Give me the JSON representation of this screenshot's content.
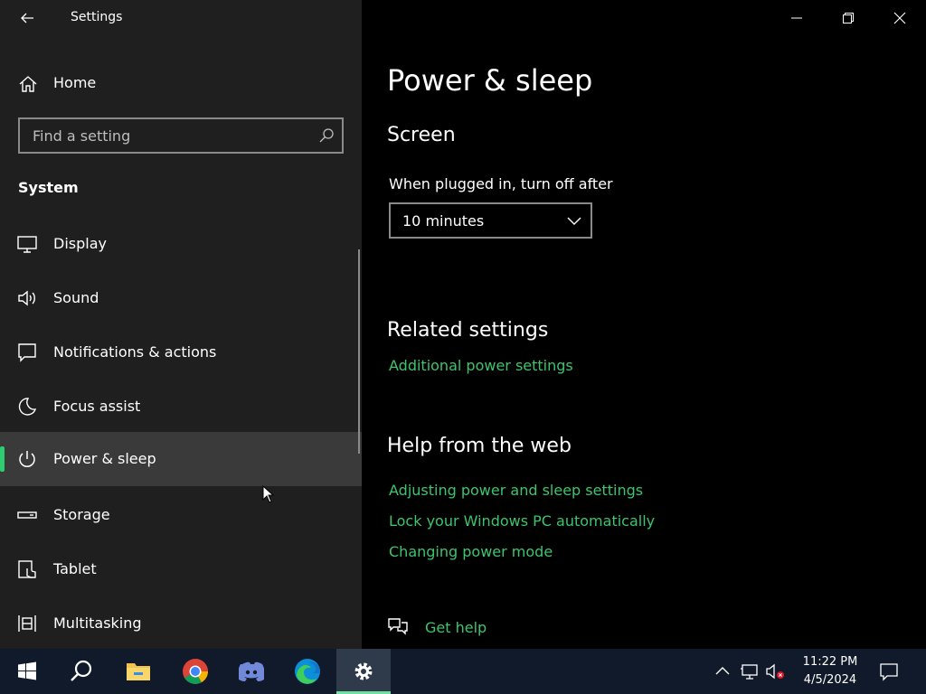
{
  "window": {
    "title": "Settings",
    "minimize_icon": "minimize-icon",
    "restore_icon": "restore-icon",
    "close_icon": "close-icon"
  },
  "sidebar": {
    "home_label": "Home",
    "search_placeholder": "Find a setting",
    "section_title": "System",
    "items": [
      {
        "label": "Display",
        "icon": "display-icon"
      },
      {
        "label": "Sound",
        "icon": "sound-icon"
      },
      {
        "label": "Notifications & actions",
        "icon": "notifications-icon"
      },
      {
        "label": "Focus assist",
        "icon": "moon-icon"
      },
      {
        "label": "Power & sleep",
        "icon": "power-icon",
        "selected": true
      },
      {
        "label": "Storage",
        "icon": "storage-icon"
      },
      {
        "label": "Tablet",
        "icon": "tablet-icon"
      },
      {
        "label": "Multitasking",
        "icon": "multitasking-icon"
      }
    ]
  },
  "main": {
    "page_title": "Power & sleep",
    "screen_title": "Screen",
    "plugged_label": "When plugged in, turn off after",
    "plugged_value": "10 minutes",
    "related_title": "Related settings",
    "related_links": [
      "Additional power settings"
    ],
    "help_title": "Help from the web",
    "help_links": [
      "Adjusting power and sleep settings",
      "Lock your Windows PC automatically",
      "Changing power mode"
    ],
    "get_help": "Get help"
  },
  "taskbar": {
    "time": "11:22 PM",
    "date": "4/5/2024",
    "apps": [
      "start",
      "search",
      "file-explorer",
      "chrome",
      "discord",
      "edge",
      "settings"
    ]
  },
  "colors": {
    "accent": "#2ecc71",
    "link": "#3ec46d",
    "sidebar_bg": "#1f1f1f",
    "selected_bg": "#3a3a3a",
    "taskbar_bg": "#101a2a"
  }
}
